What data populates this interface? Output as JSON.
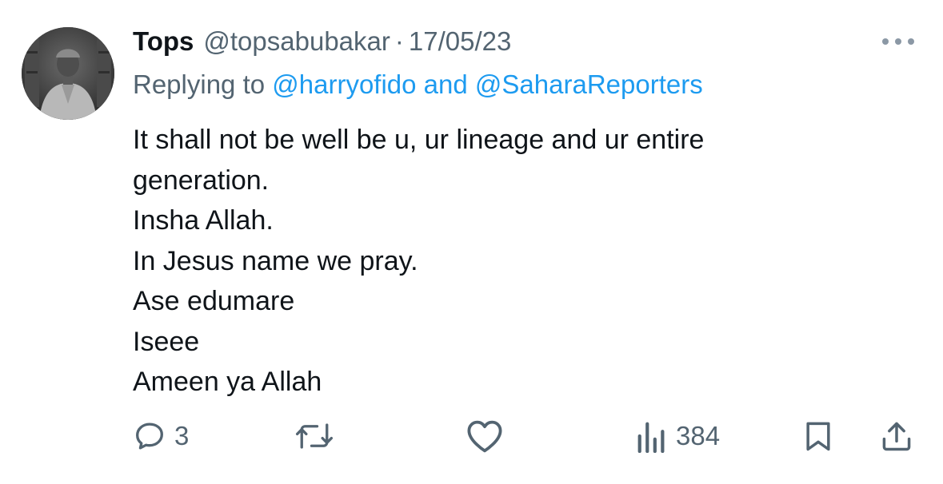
{
  "tweet": {
    "display_name": "Tops",
    "handle": "@topsabubakar",
    "separator": "·",
    "date": "17/05/23",
    "replying_prefix": "Replying to ",
    "replying_to": [
      "@harryofido",
      "@SaharaReporters"
    ],
    "replying_joiner": " and ",
    "body_lines": [
      "It shall not be well be u, ur lineage and ur entire",
      "generation.",
      "Insha Allah.",
      "In Jesus name we pray.",
      "Ase edumare",
      "Iseee",
      "Ameen ya Allah"
    ]
  },
  "actions": {
    "reply_count": "3",
    "retweet_count": "",
    "like_count": "",
    "views_count": "384"
  },
  "icons": {
    "more": "more-horizontal-icon",
    "reply": "reply-bubble-icon",
    "retweet": "retweet-icon",
    "like": "heart-icon",
    "views": "views-bar-chart-icon",
    "bookmark": "bookmark-icon",
    "share": "share-upload-icon"
  },
  "colors": {
    "text": "#0f1419",
    "secondary": "#536471",
    "link": "#1d9bf0",
    "background": "#ffffff"
  }
}
